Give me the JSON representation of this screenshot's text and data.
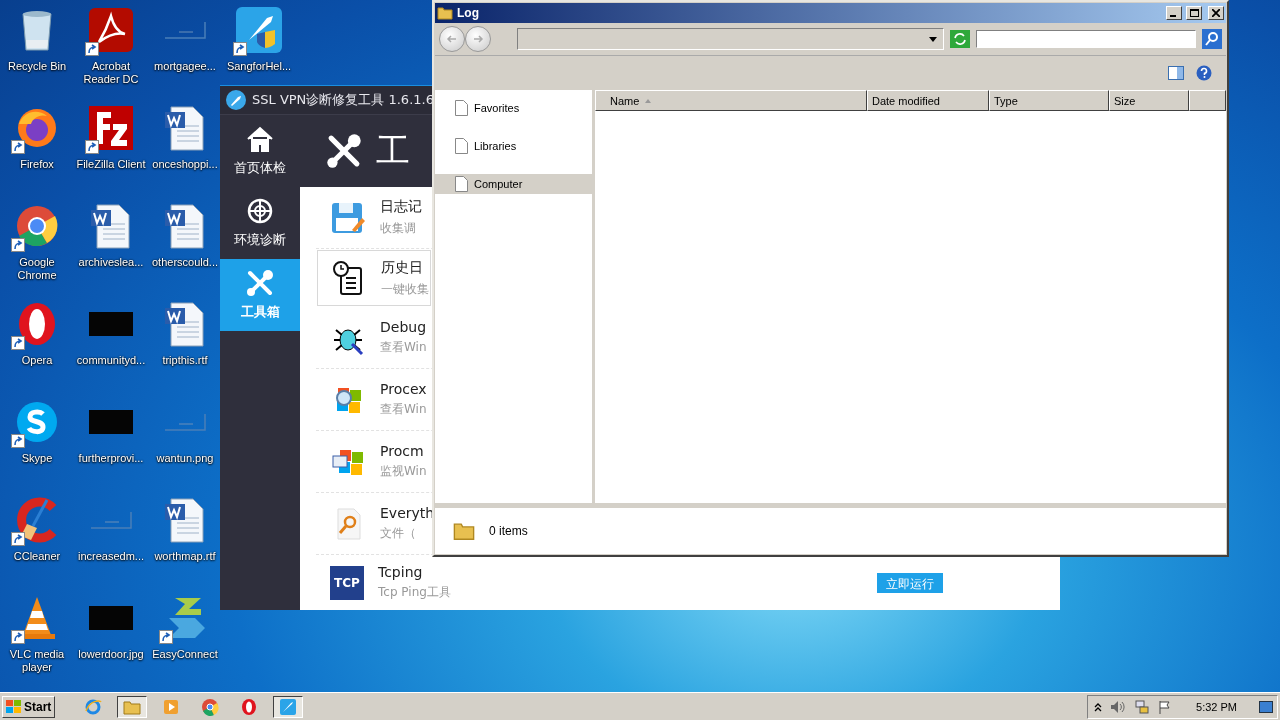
{
  "desktop_icons": [
    {
      "label": "Recycle Bin",
      "kind": "recycle",
      "shortcut": false
    },
    {
      "label": "Firefox",
      "kind": "firefox",
      "shortcut": true
    },
    {
      "label": "Google Chrome",
      "kind": "chrome",
      "shortcut": true
    },
    {
      "label": "Opera",
      "kind": "opera",
      "shortcut": true
    },
    {
      "label": "Skype",
      "kind": "skype",
      "shortcut": true
    },
    {
      "label": "CCleaner",
      "kind": "ccleaner",
      "shortcut": true
    },
    {
      "label": "VLC media player",
      "kind": "vlc",
      "shortcut": true
    },
    {
      "label": "Acrobat Reader DC",
      "kind": "acrobat",
      "shortcut": true
    },
    {
      "label": "FileZilla Client",
      "kind": "filezilla",
      "shortcut": true
    },
    {
      "label": "archiveslea...",
      "kind": "word",
      "shortcut": false
    },
    {
      "label": "communityd...",
      "kind": "dark-thumb",
      "shortcut": false
    },
    {
      "label": "furtherprovi...",
      "kind": "dark-thumb",
      "shortcut": false
    },
    {
      "label": "increasedm...",
      "kind": "thumb",
      "shortcut": false
    },
    {
      "label": "lowerdoor.jpg",
      "kind": "dark-thumb",
      "shortcut": false
    },
    {
      "label": "mortgagee...",
      "kind": "thumb",
      "shortcut": false
    },
    {
      "label": "onceshoppi...",
      "kind": "word",
      "shortcut": false
    },
    {
      "label": "otherscould...",
      "kind": "word",
      "shortcut": false
    },
    {
      "label": "tripthis.rtf",
      "kind": "word",
      "shortcut": false
    },
    {
      "label": "wantun.png",
      "kind": "thumb",
      "shortcut": false
    },
    {
      "label": "worthmap.rtf",
      "kind": "word",
      "shortcut": false
    },
    {
      "label": "EasyConnect",
      "kind": "easyconnect",
      "shortcut": true
    },
    {
      "label": "SangforHel...",
      "kind": "sangfor",
      "shortcut": true
    }
  ],
  "vpn_window": {
    "title": "SSL VPN诊断修复工具 1.6.1.6",
    "nav": [
      {
        "label": "首页体检",
        "kind": "home",
        "selected": false
      },
      {
        "label": "环境诊断",
        "kind": "target",
        "selected": false
      },
      {
        "label": "工具箱",
        "kind": "tools",
        "selected": true
      }
    ],
    "header_title": "工",
    "tools": [
      {
        "kind": "floppy",
        "name": "日志记",
        "description": "收集调",
        "highlighted": false
      },
      {
        "kind": "clock-document",
        "name": "历史日",
        "description": "一键收集",
        "highlighted": true
      },
      {
        "kind": "bug",
        "name": "Debug",
        "description": "查看Win",
        "highlighted": false
      },
      {
        "kind": "window-magnifier",
        "name": "Procex",
        "description": "查看Win",
        "highlighted": false
      },
      {
        "kind": "window-monitor",
        "name": "Procm",
        "description": "监视Win",
        "highlighted": false
      },
      {
        "kind": "magnifier-document",
        "name": "Everyth",
        "description": "文件（",
        "highlighted": false
      },
      {
        "kind": "tcp",
        "icon_text": "TCP",
        "name": "Tcping",
        "description": "Tcp Ping工具",
        "highlighted": false,
        "action": "立即运行"
      }
    ]
  },
  "explorer": {
    "title": "Log",
    "nav_pane": [
      {
        "label": "Favorites",
        "selected": false
      },
      {
        "label": "Libraries",
        "selected": false
      },
      {
        "label": "Computer",
        "selected": true
      }
    ],
    "columns": [
      {
        "label": "Name",
        "sorted": true
      },
      {
        "label": "Date modified",
        "sorted": false
      },
      {
        "label": "Type",
        "sorted": false
      },
      {
        "label": "Size",
        "sorted": false
      }
    ],
    "status": "0 items"
  },
  "taskbar": {
    "start": "Start",
    "apps": [
      {
        "kind": "ie",
        "active": false
      },
      {
        "kind": "explorer",
        "active": true
      },
      {
        "kind": "media",
        "active": false
      },
      {
        "kind": "chrome",
        "active": false
      },
      {
        "kind": "opera",
        "active": false
      },
      {
        "kind": "sangfor",
        "active": true
      }
    ],
    "clock": "5:32 PM"
  }
}
